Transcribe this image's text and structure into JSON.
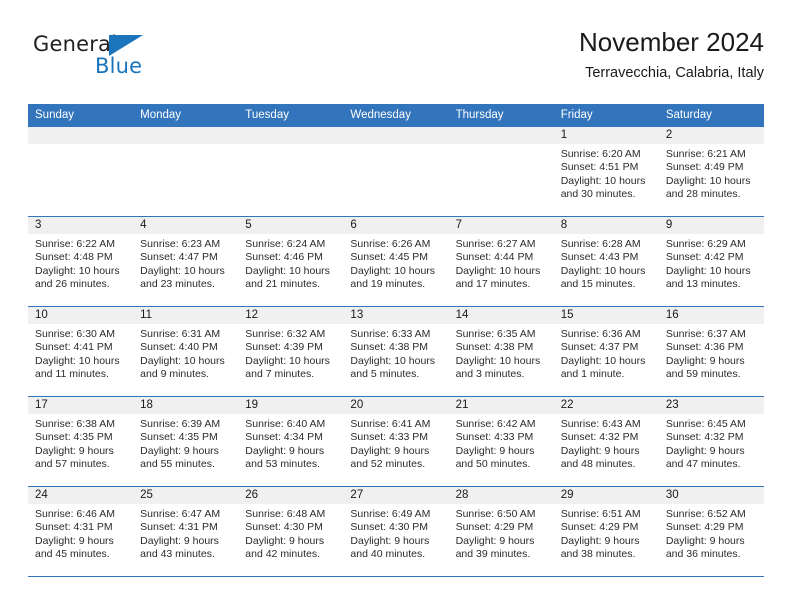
{
  "logo": {
    "word_dark": "General",
    "word_blue": "Blue",
    "mark": "blue-triangle"
  },
  "header": {
    "title": "November 2024",
    "subtitle": "Terravecchia, Calabria, Italy"
  },
  "colors": {
    "header_blue": "#3275bc",
    "logo_blue": "#1b75bc",
    "date_band": "#f0f0f0",
    "text": "#1a1a1a"
  },
  "weekdays": [
    "Sunday",
    "Monday",
    "Tuesday",
    "Wednesday",
    "Thursday",
    "Friday",
    "Saturday"
  ],
  "labels": {
    "sunrise": "Sunrise:",
    "sunset": "Sunset:",
    "daylight": "Daylight:"
  },
  "weeks": [
    [
      {
        "day": "",
        "empty": true
      },
      {
        "day": "",
        "empty": true
      },
      {
        "day": "",
        "empty": true
      },
      {
        "day": "",
        "empty": true
      },
      {
        "day": "",
        "empty": true
      },
      {
        "day": "1",
        "sunrise": "Sunrise: 6:20 AM",
        "sunset": "Sunset: 4:51 PM",
        "daylight1": "Daylight: 10 hours",
        "daylight2": "and 30 minutes."
      },
      {
        "day": "2",
        "sunrise": "Sunrise: 6:21 AM",
        "sunset": "Sunset: 4:49 PM",
        "daylight1": "Daylight: 10 hours",
        "daylight2": "and 28 minutes."
      }
    ],
    [
      {
        "day": "3",
        "sunrise": "Sunrise: 6:22 AM",
        "sunset": "Sunset: 4:48 PM",
        "daylight1": "Daylight: 10 hours",
        "daylight2": "and 26 minutes."
      },
      {
        "day": "4",
        "sunrise": "Sunrise: 6:23 AM",
        "sunset": "Sunset: 4:47 PM",
        "daylight1": "Daylight: 10 hours",
        "daylight2": "and 23 minutes."
      },
      {
        "day": "5",
        "sunrise": "Sunrise: 6:24 AM",
        "sunset": "Sunset: 4:46 PM",
        "daylight1": "Daylight: 10 hours",
        "daylight2": "and 21 minutes."
      },
      {
        "day": "6",
        "sunrise": "Sunrise: 6:26 AM",
        "sunset": "Sunset: 4:45 PM",
        "daylight1": "Daylight: 10 hours",
        "daylight2": "and 19 minutes."
      },
      {
        "day": "7",
        "sunrise": "Sunrise: 6:27 AM",
        "sunset": "Sunset: 4:44 PM",
        "daylight1": "Daylight: 10 hours",
        "daylight2": "and 17 minutes."
      },
      {
        "day": "8",
        "sunrise": "Sunrise: 6:28 AM",
        "sunset": "Sunset: 4:43 PM",
        "daylight1": "Daylight: 10 hours",
        "daylight2": "and 15 minutes."
      },
      {
        "day": "9",
        "sunrise": "Sunrise: 6:29 AM",
        "sunset": "Sunset: 4:42 PM",
        "daylight1": "Daylight: 10 hours",
        "daylight2": "and 13 minutes."
      }
    ],
    [
      {
        "day": "10",
        "sunrise": "Sunrise: 6:30 AM",
        "sunset": "Sunset: 4:41 PM",
        "daylight1": "Daylight: 10 hours",
        "daylight2": "and 11 minutes."
      },
      {
        "day": "11",
        "sunrise": "Sunrise: 6:31 AM",
        "sunset": "Sunset: 4:40 PM",
        "daylight1": "Daylight: 10 hours",
        "daylight2": "and 9 minutes."
      },
      {
        "day": "12",
        "sunrise": "Sunrise: 6:32 AM",
        "sunset": "Sunset: 4:39 PM",
        "daylight1": "Daylight: 10 hours",
        "daylight2": "and 7 minutes."
      },
      {
        "day": "13",
        "sunrise": "Sunrise: 6:33 AM",
        "sunset": "Sunset: 4:38 PM",
        "daylight1": "Daylight: 10 hours",
        "daylight2": "and 5 minutes."
      },
      {
        "day": "14",
        "sunrise": "Sunrise: 6:35 AM",
        "sunset": "Sunset: 4:38 PM",
        "daylight1": "Daylight: 10 hours",
        "daylight2": "and 3 minutes."
      },
      {
        "day": "15",
        "sunrise": "Sunrise: 6:36 AM",
        "sunset": "Sunset: 4:37 PM",
        "daylight1": "Daylight: 10 hours",
        "daylight2": "and 1 minute."
      },
      {
        "day": "16",
        "sunrise": "Sunrise: 6:37 AM",
        "sunset": "Sunset: 4:36 PM",
        "daylight1": "Daylight: 9 hours",
        "daylight2": "and 59 minutes."
      }
    ],
    [
      {
        "day": "17",
        "sunrise": "Sunrise: 6:38 AM",
        "sunset": "Sunset: 4:35 PM",
        "daylight1": "Daylight: 9 hours",
        "daylight2": "and 57 minutes."
      },
      {
        "day": "18",
        "sunrise": "Sunrise: 6:39 AM",
        "sunset": "Sunset: 4:35 PM",
        "daylight1": "Daylight: 9 hours",
        "daylight2": "and 55 minutes."
      },
      {
        "day": "19",
        "sunrise": "Sunrise: 6:40 AM",
        "sunset": "Sunset: 4:34 PM",
        "daylight1": "Daylight: 9 hours",
        "daylight2": "and 53 minutes."
      },
      {
        "day": "20",
        "sunrise": "Sunrise: 6:41 AM",
        "sunset": "Sunset: 4:33 PM",
        "daylight1": "Daylight: 9 hours",
        "daylight2": "and 52 minutes."
      },
      {
        "day": "21",
        "sunrise": "Sunrise: 6:42 AM",
        "sunset": "Sunset: 4:33 PM",
        "daylight1": "Daylight: 9 hours",
        "daylight2": "and 50 minutes."
      },
      {
        "day": "22",
        "sunrise": "Sunrise: 6:43 AM",
        "sunset": "Sunset: 4:32 PM",
        "daylight1": "Daylight: 9 hours",
        "daylight2": "and 48 minutes."
      },
      {
        "day": "23",
        "sunrise": "Sunrise: 6:45 AM",
        "sunset": "Sunset: 4:32 PM",
        "daylight1": "Daylight: 9 hours",
        "daylight2": "and 47 minutes."
      }
    ],
    [
      {
        "day": "24",
        "sunrise": "Sunrise: 6:46 AM",
        "sunset": "Sunset: 4:31 PM",
        "daylight1": "Daylight: 9 hours",
        "daylight2": "and 45 minutes."
      },
      {
        "day": "25",
        "sunrise": "Sunrise: 6:47 AM",
        "sunset": "Sunset: 4:31 PM",
        "daylight1": "Daylight: 9 hours",
        "daylight2": "and 43 minutes."
      },
      {
        "day": "26",
        "sunrise": "Sunrise: 6:48 AM",
        "sunset": "Sunset: 4:30 PM",
        "daylight1": "Daylight: 9 hours",
        "daylight2": "and 42 minutes."
      },
      {
        "day": "27",
        "sunrise": "Sunrise: 6:49 AM",
        "sunset": "Sunset: 4:30 PM",
        "daylight1": "Daylight: 9 hours",
        "daylight2": "and 40 minutes."
      },
      {
        "day": "28",
        "sunrise": "Sunrise: 6:50 AM",
        "sunset": "Sunset: 4:29 PM",
        "daylight1": "Daylight: 9 hours",
        "daylight2": "and 39 minutes."
      },
      {
        "day": "29",
        "sunrise": "Sunrise: 6:51 AM",
        "sunset": "Sunset: 4:29 PM",
        "daylight1": "Daylight: 9 hours",
        "daylight2": "and 38 minutes."
      },
      {
        "day": "30",
        "sunrise": "Sunrise: 6:52 AM",
        "sunset": "Sunset: 4:29 PM",
        "daylight1": "Daylight: 9 hours",
        "daylight2": "and 36 minutes."
      }
    ]
  ]
}
